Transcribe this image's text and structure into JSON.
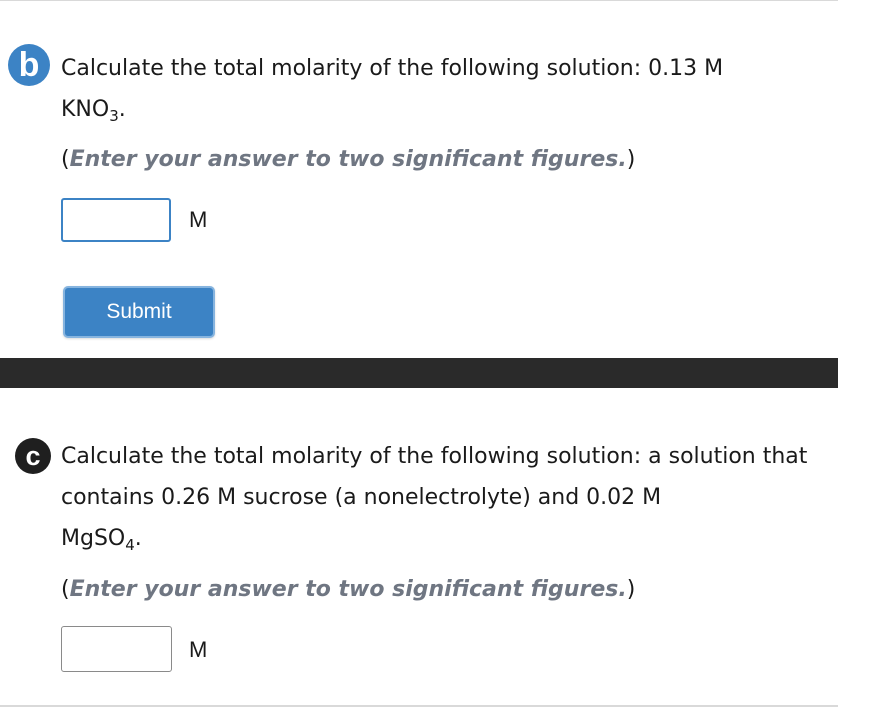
{
  "part_b": {
    "badge": "b",
    "question_line1": "Calculate the total molarity of the following solution: 0.13 M",
    "compound_main": "KNO",
    "compound_sub": "3",
    "compound_suffix": ".",
    "hint_open": "(",
    "hint_text": "Enter your answer to two significant figures.",
    "hint_close": ")",
    "input_value": "",
    "unit": "M",
    "submit_label": "Submit"
  },
  "part_c": {
    "badge": "c",
    "question_line1": "Calculate the total molarity of the following solution: a solution that contains 0.26 M sucrose (a nonelectrolyte) and 0.02 M",
    "compound_main": "MgSO",
    "compound_sub": "4",
    "compound_suffix": ".",
    "hint_open": "(",
    "hint_text": "Enter your answer to two significant figures.",
    "hint_close": ")",
    "input_value": "",
    "unit": "M"
  },
  "colors": {
    "accent": "#3c83c5",
    "hint": "#6f7682",
    "divider": "#2a2a2a",
    "badge_c": "#1f1f1f"
  }
}
